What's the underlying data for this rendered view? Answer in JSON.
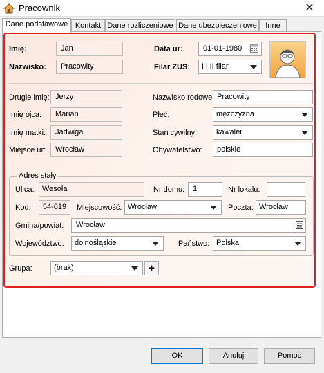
{
  "window": {
    "title": "Pracownik",
    "close_glyph": "✕"
  },
  "tabs": [
    "Dane podstawowe",
    "Kontakt",
    "Dane rozliczeniowe",
    "Dane ubezpieczeniowe",
    "Inne"
  ],
  "top": {
    "imie_label": "Imię:",
    "imie": "Jan",
    "nazwisko_label": "Nazwisko:",
    "nazwisko": "Pracowity",
    "data_label": "Data ur:",
    "data": "01-01-1980",
    "filar_label": "Filar ZUS:",
    "filar": "I i II filar"
  },
  "details": {
    "drugie_imie_label": "Drugie imię:",
    "drugie_imie": "Jerzy",
    "imie_ojca_label": "Imię ojca:",
    "imie_ojca": "Marian",
    "imie_matki_label": "Imię matki:",
    "imie_matki": "Jadwiga",
    "miejsce_ur_label": "Miejsce ur:",
    "miejsce_ur": "Wrocław",
    "nazwisko_rodowe_label": "Nazwisko rodowe:",
    "nazwisko_rodowe": "Pracowity",
    "plec_label": "Płeć:",
    "plec": "mężczyzna",
    "stan_label": "Stan cywilny:",
    "stan": "kawaler",
    "obywatelstwo_label": "Obywatelstwo:",
    "obywatelstwo": "polskie"
  },
  "address": {
    "legend": "Adres stały",
    "ulica_label": "Ulica:",
    "ulica": "Wesoła",
    "nr_domu_label": "Nr domu:",
    "nr_domu": "1",
    "nr_lokalu_label": "Nr lokalu:",
    "nr_lokalu": "",
    "kod_label": "Kod:",
    "kod": "54-619",
    "miejscowosc_label": "Miejscowość:",
    "miejscowosc": "Wrocław",
    "poczta_label": "Poczta:",
    "poczta": "Wrocław",
    "gmina_label": "Gmina/powiat:",
    "gmina": "Wrocław",
    "woj_label": "Województwo:",
    "woj": "dolnośląskie",
    "panstwo_label": "Państwo:",
    "panstwo": "Polska"
  },
  "grupa": {
    "label": "Grupa:",
    "value": "(brak)",
    "add_glyph": "+"
  },
  "buttons": {
    "ok": "OK",
    "cancel": "Anuluj",
    "help": "Pomoc"
  },
  "colors": {
    "highlight_border": "#e02020",
    "field_bg": "#fcefe9",
    "default_button_border": "#0078d7"
  }
}
